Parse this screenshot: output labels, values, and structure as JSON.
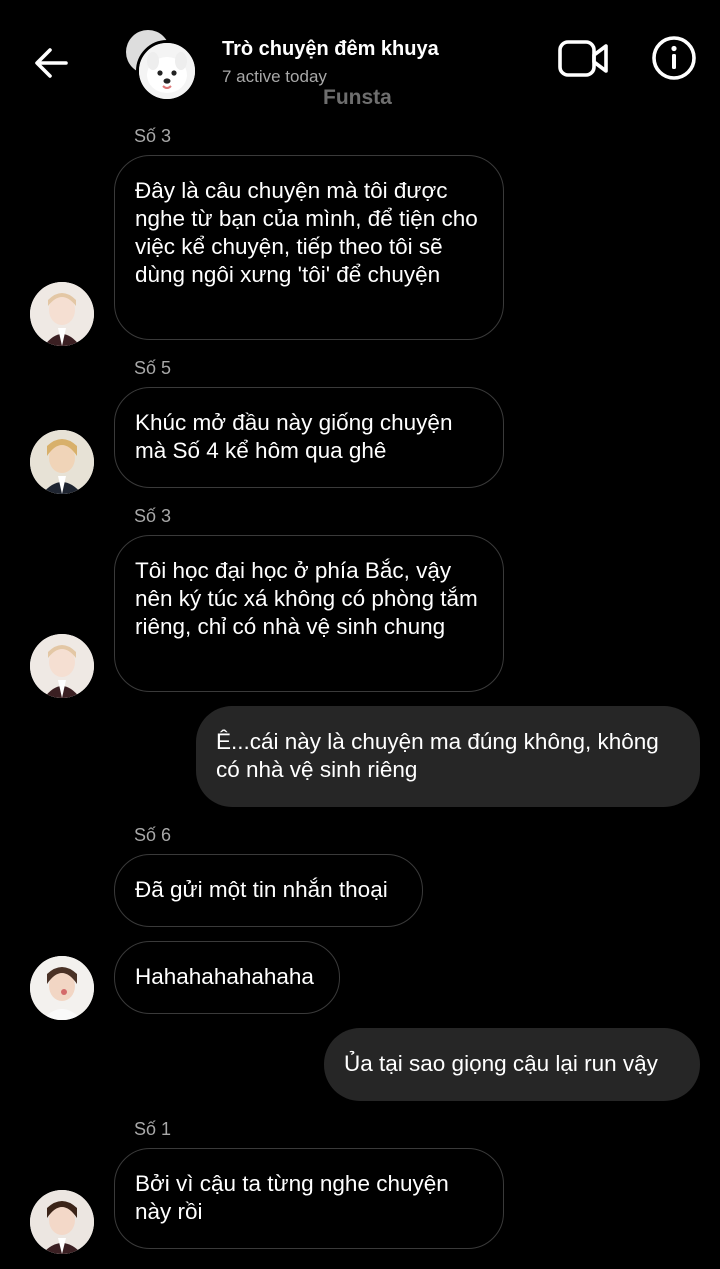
{
  "header": {
    "title": "Trò chuyện đêm khuya",
    "subtitle": "7 active today",
    "watermark": "Funsta",
    "icons": {
      "back": "arrow-left-icon",
      "video": "video-call-icon",
      "info": "info-icon"
    }
  },
  "messages": [
    {
      "sender": "Số 3",
      "text": "Đây là câu chuyện mà tôi được nghe từ bạn của mình, để tiện cho việc kể chuyện, tiếp theo tôi sẽ dùng ngôi xưng 'tôi' để chuyện"
    },
    {
      "sender": "Số 5",
      "text": "Khúc mở đầu này giống chuyện mà Số 4 kể hôm qua ghê"
    },
    {
      "sender": "Số 3",
      "text": "Tôi học đại học ở phía Bắc, vậy nên ký túc xá không có phòng tắm riêng, chỉ có nhà vệ sinh chung"
    },
    {
      "outgoing": true,
      "text": "Ê...cái này là chuyện ma đúng không, không có nhà vệ sinh riêng"
    },
    {
      "sender": "Số 6",
      "text": "Đã gửi một tin nhắn thoại"
    },
    {
      "text": "Hahahahahahaha"
    },
    {
      "outgoing": true,
      "text": "Ủa tại sao giọng cậu lại run vậy"
    },
    {
      "sender": "Số 1",
      "text": "Bởi vì cậu ta từng nghe chuyện này rồi"
    }
  ],
  "colors": {
    "background": "#000000",
    "incoming_border": "#3a3a3a",
    "outgoing_bg": "#262626",
    "secondary_text": "#a8a8a8"
  }
}
